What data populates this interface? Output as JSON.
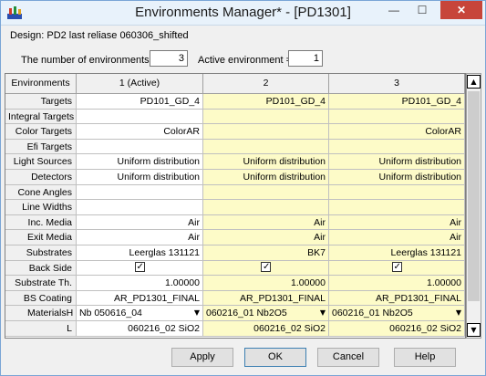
{
  "window": {
    "title": "Environments Manager* - [PD1301]",
    "minimize": "—",
    "maximize": "☐",
    "close": "✕"
  },
  "design_label": "Design: PD2 last reliase 060306_shifted",
  "count": {
    "label": "The number of environments =",
    "value": "3"
  },
  "active": {
    "label": "Active environment =",
    "value": "1"
  },
  "grid": {
    "columns": [
      "Environments",
      "1 (Active)",
      "2",
      "3"
    ],
    "rows": [
      {
        "label": "Targets",
        "values": [
          "PD101_GD_4",
          "PD101_GD_4",
          "PD101_GD_4"
        ]
      },
      {
        "label": "Integral Targets",
        "values": [
          "",
          "",
          ""
        ]
      },
      {
        "label": "Color Targets",
        "values": [
          "ColorAR",
          "",
          "ColorAR"
        ]
      },
      {
        "label": "Efi Targets",
        "values": [
          "",
          "",
          ""
        ]
      },
      {
        "label": "Light Sources",
        "values": [
          "Uniform distribution",
          "Uniform distribution",
          "Uniform distribution"
        ]
      },
      {
        "label": "Detectors",
        "values": [
          "Uniform distribution",
          "Uniform distribution",
          "Uniform distribution"
        ]
      },
      {
        "label": "Cone Angles",
        "values": [
          "",
          "",
          ""
        ]
      },
      {
        "label": "Line Widths",
        "values": [
          "",
          "",
          ""
        ]
      },
      {
        "label": "Inc. Media",
        "values": [
          "Air",
          "Air",
          "Air"
        ]
      },
      {
        "label": "Exit Media",
        "values": [
          "Air",
          "Air",
          "Air"
        ]
      },
      {
        "label": "Substrates",
        "values": [
          "Leerglas 131121",
          "BK7",
          "Leerglas 131121"
        ]
      },
      {
        "label": "Back Side",
        "values": [
          "",
          "",
          ""
        ],
        "checked": [
          true,
          true,
          true
        ]
      },
      {
        "label": "Substrate Th.",
        "values": [
          "1.00000",
          "1.00000",
          "1.00000"
        ]
      },
      {
        "label": "BS Coating",
        "values": [
          "AR_PD1301_FINAL",
          "AR_PD1301_FINAL",
          "AR_PD1301_FINAL"
        ]
      },
      {
        "label": "Materials",
        "sub": "H",
        "values": [
          "Nb 050616_04",
          "060216_01 Nb2O5",
          "060216_01 Nb2O5"
        ]
      },
      {
        "label": "",
        "sub": "L",
        "values": [
          "060216_02 SiO2",
          "060216_02 SiO2",
          "060216_02 SiO2"
        ]
      }
    ]
  },
  "buttons": {
    "apply": "Apply",
    "ok": "OK",
    "cancel": "Cancel",
    "help": "Help"
  },
  "colors": {
    "active_column_bg": "#ffffff",
    "other_columns_bg": "#fdfbc8",
    "header_bg": "#f0f0f0"
  }
}
